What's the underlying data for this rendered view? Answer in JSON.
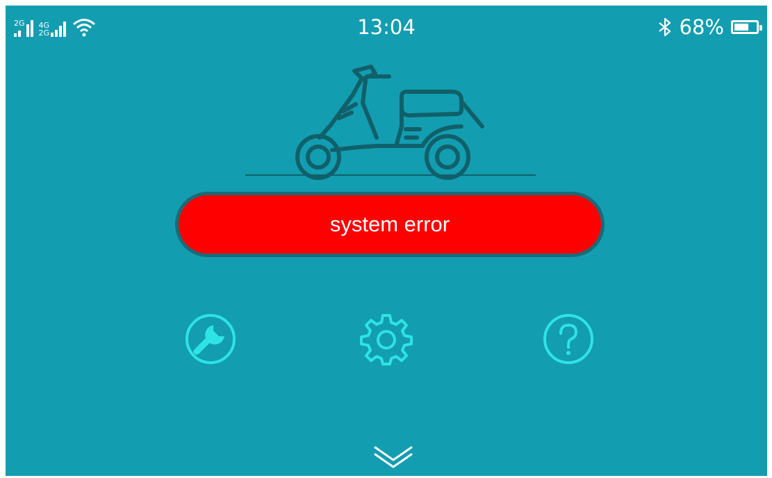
{
  "status_bar": {
    "sim1_label": "2G",
    "sim2_label_top": "4G",
    "sim2_label_bottom": "2G",
    "time": "13:04",
    "bluetooth_icon": "bluetooth-icon",
    "battery_percent_text": "68%",
    "battery_level": 0.68
  },
  "main": {
    "vehicle_icon": "scooter-icon",
    "status_message": "system error",
    "status_color": "#FF0000"
  },
  "actions": [
    {
      "icon": "wrench-icon"
    },
    {
      "icon": "gear-icon"
    },
    {
      "icon": "help-icon"
    }
  ],
  "footer": {
    "expand_icon": "chevron-down-icon"
  },
  "colors": {
    "background": "#139DB0",
    "accent": "#2DE3E6",
    "outline": "#10606A"
  }
}
